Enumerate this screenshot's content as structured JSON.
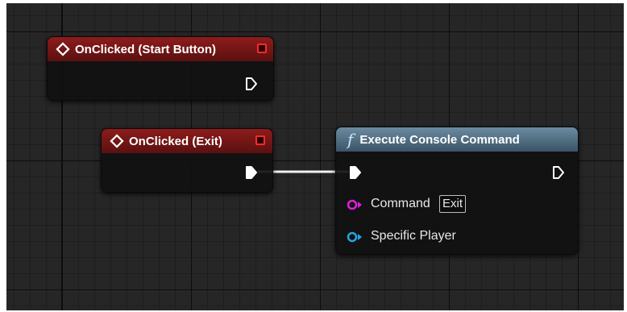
{
  "nodes": {
    "start": {
      "title": "OnClicked (Start Button)",
      "icon": "event-diamond-icon"
    },
    "exit": {
      "title": "OnClicked (Exit)",
      "icon": "event-diamond-icon"
    },
    "console": {
      "title": "Execute Console Command",
      "icon": "function-icon",
      "icon_glyph": "f",
      "pins": {
        "command_label": "Command",
        "command_value": "Exit",
        "player_label": "Specific Player"
      }
    }
  },
  "colors": {
    "event_header": "#8e1c1c",
    "function_header": "#4f6e84",
    "string_pin": "#e01ee0",
    "object_pin": "#21a7e6",
    "exec_wire": "#ffffff"
  }
}
